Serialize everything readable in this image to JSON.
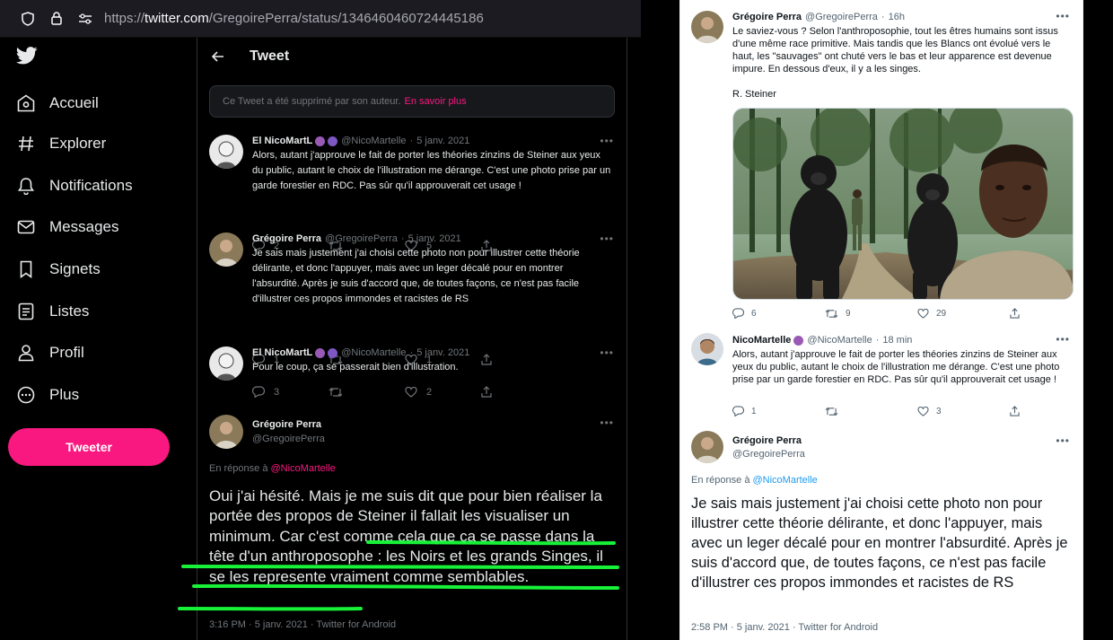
{
  "browser": {
    "url_prefix": "https://",
    "url_domain": "twitter.com",
    "url_path": "/GregoirePerra/status/1346460460724445186"
  },
  "sidebar": {
    "items": [
      {
        "label": "Accueil",
        "icon": "home-icon"
      },
      {
        "label": "Explorer",
        "icon": "hashtag-icon"
      },
      {
        "label": "Notifications",
        "icon": "bell-icon"
      },
      {
        "label": "Messages",
        "icon": "envelope-icon"
      },
      {
        "label": "Signets",
        "icon": "bookmark-icon"
      },
      {
        "label": "Listes",
        "icon": "list-icon"
      },
      {
        "label": "Profil",
        "icon": "person-icon"
      },
      {
        "label": "Plus",
        "icon": "more-circle-icon"
      }
    ],
    "tweet_button": "Tweeter"
  },
  "thread": {
    "header_title": "Tweet",
    "deleted_notice": "Ce Tweet a été supprimé par son auteur.",
    "deleted_link": "En savoir plus",
    "replies": [
      {
        "name": "El NicoMartL",
        "handle": "@NicoMartelle",
        "date": "5 janv. 2021",
        "text": "Alors, autant j'approuve le fait de porter les théories zinzins de Steiner aux yeux du public, autant le choix de l'illustration me dérange. C'est une photo prise par un garde forestier en RDC. Pas sûr qu'il approuverait cet usage !",
        "replies": "2",
        "retweets": "",
        "likes": "5"
      },
      {
        "name": "Grégoire Perra",
        "handle": "@GregoirePerra",
        "date": "5 janv. 2021",
        "text": "Je sais mais justement j'ai choisi cette photo non pour illustrer cette théorie délirante, et donc l'appuyer, mais avec un leger décalé pour en montrer l'absurdité. Après je suis d'accord que, de toutes façons, ce n'est pas facile d'illustrer ces propos immondes et racistes de RS",
        "replies": "1",
        "retweets": "",
        "likes": "1"
      },
      {
        "name": "El NicoMartL",
        "handle": "@NicoMartelle",
        "date": "5 janv. 2021",
        "text": "Pour le coup, ça se passerait bien d'illustration.",
        "replies": "3",
        "retweets": "",
        "likes": "2"
      }
    ],
    "focus": {
      "name": "Grégoire Perra",
      "handle": "@GregoirePerra",
      "in_reply_prefix": "En réponse à",
      "in_reply_handle": "@NicoMartelle",
      "text": "Oui j'ai hésité. Mais je me suis dit que pour bien réaliser la portée des propos de Steiner il fallait les visualiser un minimum. Car c'est comme cela que ça se passe dans la tête d'un anthroposophe : les Noirs et les grands Singes, il se les represente vraiment comme semblables.",
      "meta": "3:16 PM · 5 janv. 2021 · Twitter for Android"
    }
  },
  "right_panel": {
    "original": {
      "name": "Grégoire Perra",
      "handle": "@GregoirePerra",
      "date": "16h",
      "text": "Le saviez-vous ? Selon l'anthroposophie, tout les êtres humains sont issus d'une même race primitive. Mais tandis que les Blancs ont évolué vers le haut, les \"sauvages\" ont chuté vers le bas et leur apparence est devenue impure. En dessous d'eux, il y a les singes.",
      "signature": "R. Steiner",
      "replies": "6",
      "retweets": "9",
      "likes": "29"
    },
    "reply": {
      "name": "NicoMartelle",
      "handle": "@NicoMartelle",
      "date": "18 min",
      "text": "Alors, autant j'approuve le fait de porter les théories zinzins de Steiner aux yeux du public, autant le choix de l'illustration me dérange. C'est une photo prise par un garde forestier en RDC. Pas sûr qu'il approuverait cet usage !",
      "replies": "1",
      "retweets": "",
      "likes": "3"
    },
    "focus": {
      "name": "Grégoire Perra",
      "handle": "@GregoirePerra",
      "in_reply_prefix": "En réponse à",
      "in_reply_handle": "@NicoMartelle",
      "text": "Je sais mais justement j'ai choisi cette photo non pour illustrer cette théorie délirante, et donc l'appuyer, mais avec un leger décalé pour en montrer l'absurdité. Après je suis d'accord que, de toutes façons, ce n'est pas facile d'illustrer ces propos immondes et racistes de RS",
      "meta": "2:58 PM · 5 janv. 2021 · Twitter for Android"
    }
  },
  "colors": {
    "accent_dark": "#f91880",
    "accent_light": "#1d9bf0",
    "highlight": "#19ff3c"
  }
}
